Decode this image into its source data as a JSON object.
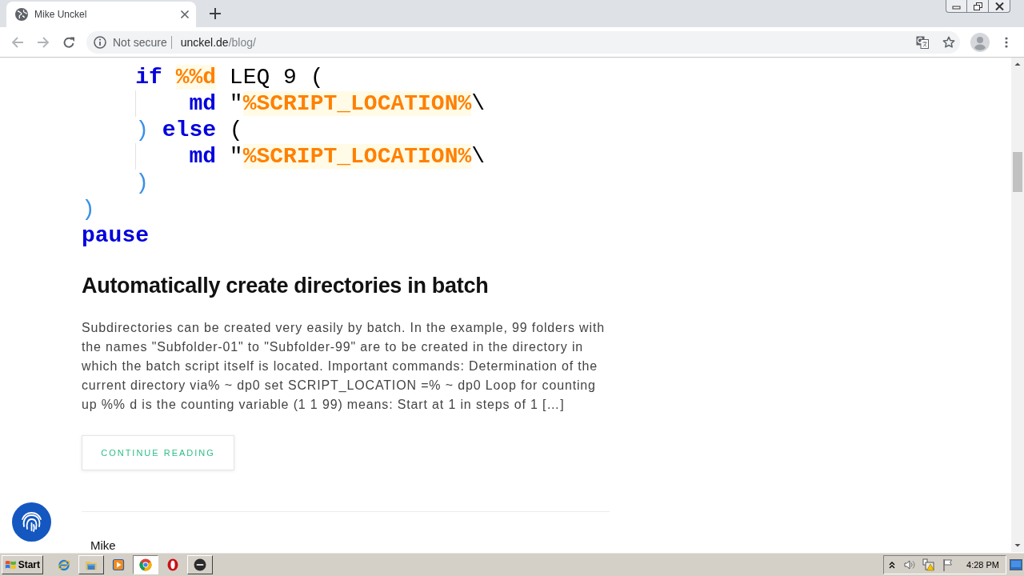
{
  "browser": {
    "tabs": [
      {
        "title": "Mike Unckel",
        "selected": true
      }
    ],
    "address_bar": {
      "security_label": "Not secure",
      "host": "unckel.de",
      "path": "/blog/"
    }
  },
  "code": {
    "lines": [
      {
        "children": [
          {
            "tokens": [
              {
                "kind": "keyword",
                "text": "if "
              },
              {
                "kind": "variable",
                "text": "%%d"
              },
              {
                "kind": "plain",
                "text": " LEQ 9 ("
              }
            ],
            "children": [
              {
                "tokens": [
                  {
                    "kind": "keyword",
                    "text": "md"
                  },
                  {
                    "kind": "plain",
                    "text": " \""
                  },
                  {
                    "kind": "variable",
                    "text": "%SCRIPT_LOCATION%"
                  },
                  {
                    "kind": "plain",
                    "text": "\\"
                  }
                ]
              }
            ]
          },
          {
            "tokens": [
              {
                "kind": "bracket",
                "text": ") "
              },
              {
                "kind": "keyword",
                "text": "else"
              },
              {
                "kind": "plain",
                "text": " ("
              }
            ],
            "children": [
              {
                "tokens": [
                  {
                    "kind": "keyword",
                    "text": "md"
                  },
                  {
                    "kind": "plain",
                    "text": " \""
                  },
                  {
                    "kind": "variable",
                    "text": "%SCRIPT_LOCATION%"
                  },
                  {
                    "kind": "plain",
                    "text": "\\"
                  }
                ]
              }
            ]
          },
          {
            "tokens": [
              {
                "kind": "bracket",
                "text": ")"
              }
            ]
          }
        ]
      },
      {
        "tokens": [
          {
            "kind": "bracket",
            "text": ")"
          }
        ]
      },
      {
        "tokens": [
          {
            "kind": "keyword",
            "text": "pause"
          }
        ]
      }
    ]
  },
  "post": {
    "title": "Automatically create directories in batch",
    "excerpt": "Subdirectories can be created very easily by batch. In the example, 99 folders with the names \"Subfolder-01\" to \"Subfolder-99\" are to be created in the directory in which the batch script itself is located. Important commands: Determination of the current directory via% ~ dp0 set SCRIPT_LOCATION =% ~ dp0 Loop for counting up %% d is the counting variable (1 1 99) means: Start at 1 in steps of 1 […]",
    "button": "CONTINUE READING"
  },
  "author": {
    "name": "Mike"
  },
  "taskbar": {
    "start_label": "Start",
    "apps": [
      {
        "kind": "ie",
        "open": false
      },
      {
        "kind": "explorer",
        "open": true,
        "selected": false
      },
      {
        "kind": "media",
        "open": false
      },
      {
        "kind": "chrome",
        "open": true,
        "selected": true
      },
      {
        "kind": "opera",
        "open": false
      },
      {
        "kind": "disc",
        "open": true,
        "selected": false
      }
    ],
    "clock": "4:28 PM"
  }
}
